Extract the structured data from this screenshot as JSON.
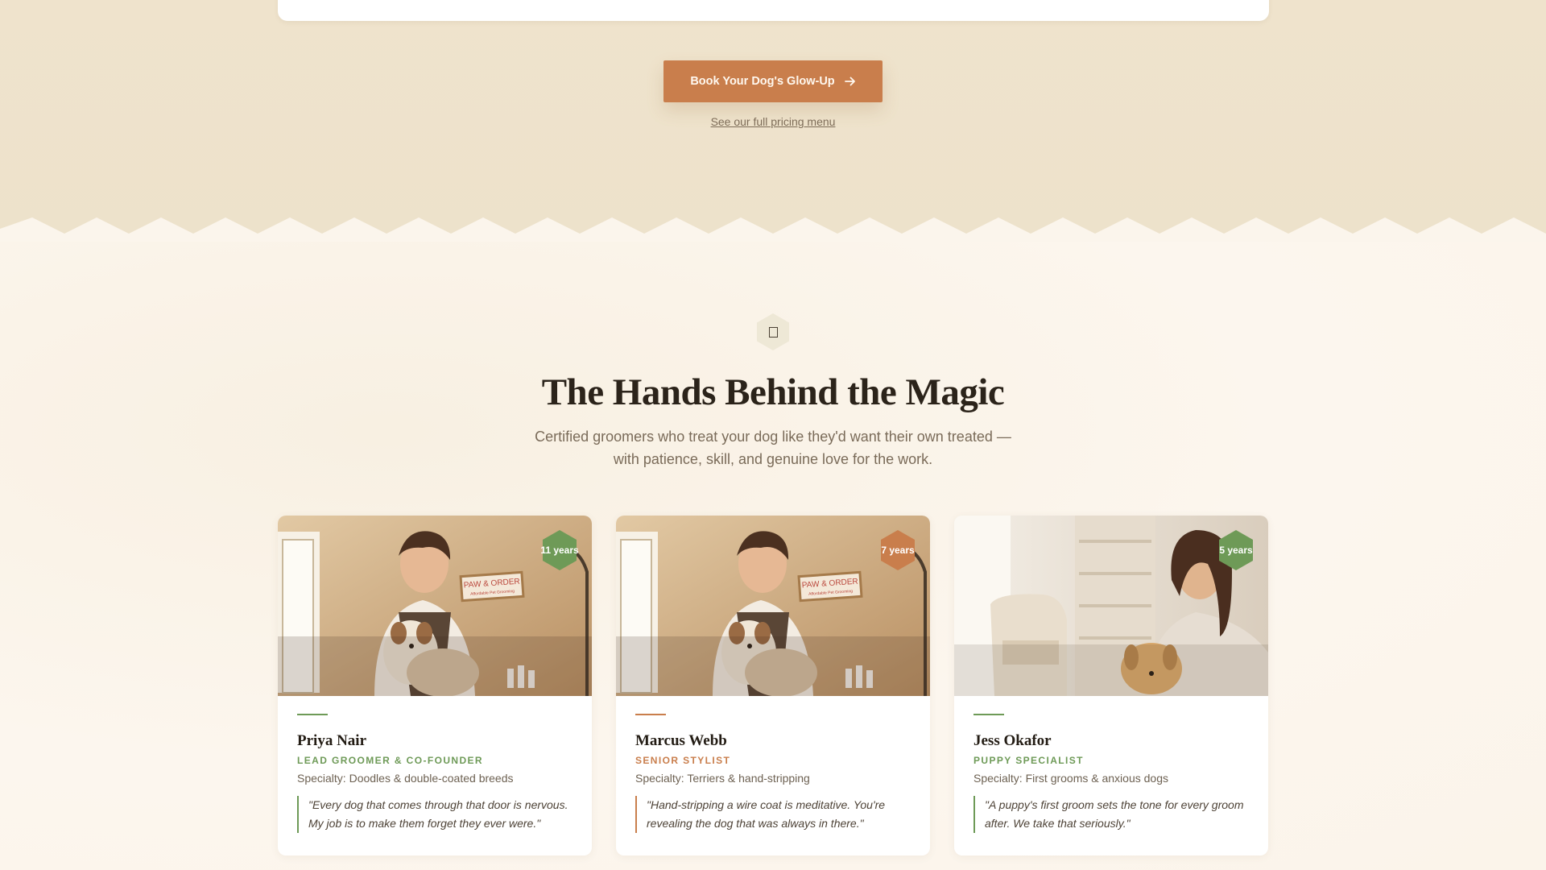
{
  "cta": {
    "book_label": "Book Your Dog's Glow-Up",
    "pricing_link": "See our full pricing menu"
  },
  "team": {
    "section_icon": "document-icon",
    "title": "The Hands Behind the Magic",
    "subtitle": "Certified groomers who treat your dog like they'd want their own treated — with patience, skill, and genuine love for the work.",
    "members": [
      {
        "name": "Priya Nair",
        "role": "LEAD GROOMER & CO-FOUNDER",
        "specialty": "Specialty: Doodles & double-coated breeds",
        "quote": "\"Every dog that comes through that door is nervous. My job is to make them forget they ever were.\"",
        "years": "11 years",
        "accent": "#6e9a57",
        "photo_sign_line1": "PAW & ORDER",
        "photo_sign_line2": "Affordable Pet Grooming"
      },
      {
        "name": "Marcus Webb",
        "role": "SENIOR STYLIST",
        "specialty": "Specialty: Terriers & hand-stripping",
        "quote": "\"Hand-stripping a wire coat is meditative. You're revealing the dog that was always in there.\"",
        "years": "7 years",
        "accent": "#c97e4c",
        "photo_sign_line1": "PAW & ORDER",
        "photo_sign_line2": "Affordable Pet Grooming"
      },
      {
        "name": "Jess Okafor",
        "role": "PUPPY SPECIALIST",
        "specialty": "Specialty: First grooms & anxious dogs",
        "quote": "\"A puppy's first groom sets the tone for every groom after. We take that seriously.\"",
        "years": "5 years",
        "accent": "#6e9a57"
      }
    ]
  },
  "colors": {
    "top_bg": "#efe3cc",
    "section_bg": "#fbf5ec",
    "cta_bg": "#c97e4c",
    "green_accent": "#6e9a57",
    "orange_accent": "#c97e4c",
    "title_text": "#2b231a"
  }
}
